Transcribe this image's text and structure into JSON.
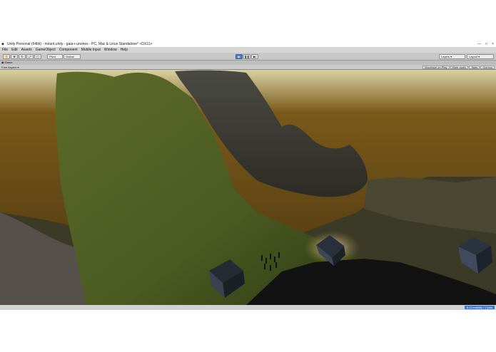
{
  "window": {
    "title": "Unity Personal (64bit) - mount.unity - gaia-r-unones - PC, Mac & Linux Standalone* <DX11>",
    "controls": [
      "—",
      "□",
      "×"
    ]
  },
  "menu": [
    "File",
    "Edit",
    "Assets",
    "GameObject",
    "Component",
    "Mobile Input",
    "Window",
    "Help"
  ],
  "toolbar": {
    "pivot_label": "Pivot",
    "global_label": "Global",
    "layers_label": "Layers",
    "layout_label": "Layout",
    "accent_color": "#4d7fc4"
  },
  "game_tab": {
    "label": "Game"
  },
  "game_controls": {
    "aspect": "Free Aspect",
    "maximize": "Maximize on Play",
    "mute": "Mute audio",
    "stats": "Stats",
    "gizmos": "Gizmos"
  },
  "status": {
    "badge": "6:11 mobility / 2 jobs"
  }
}
